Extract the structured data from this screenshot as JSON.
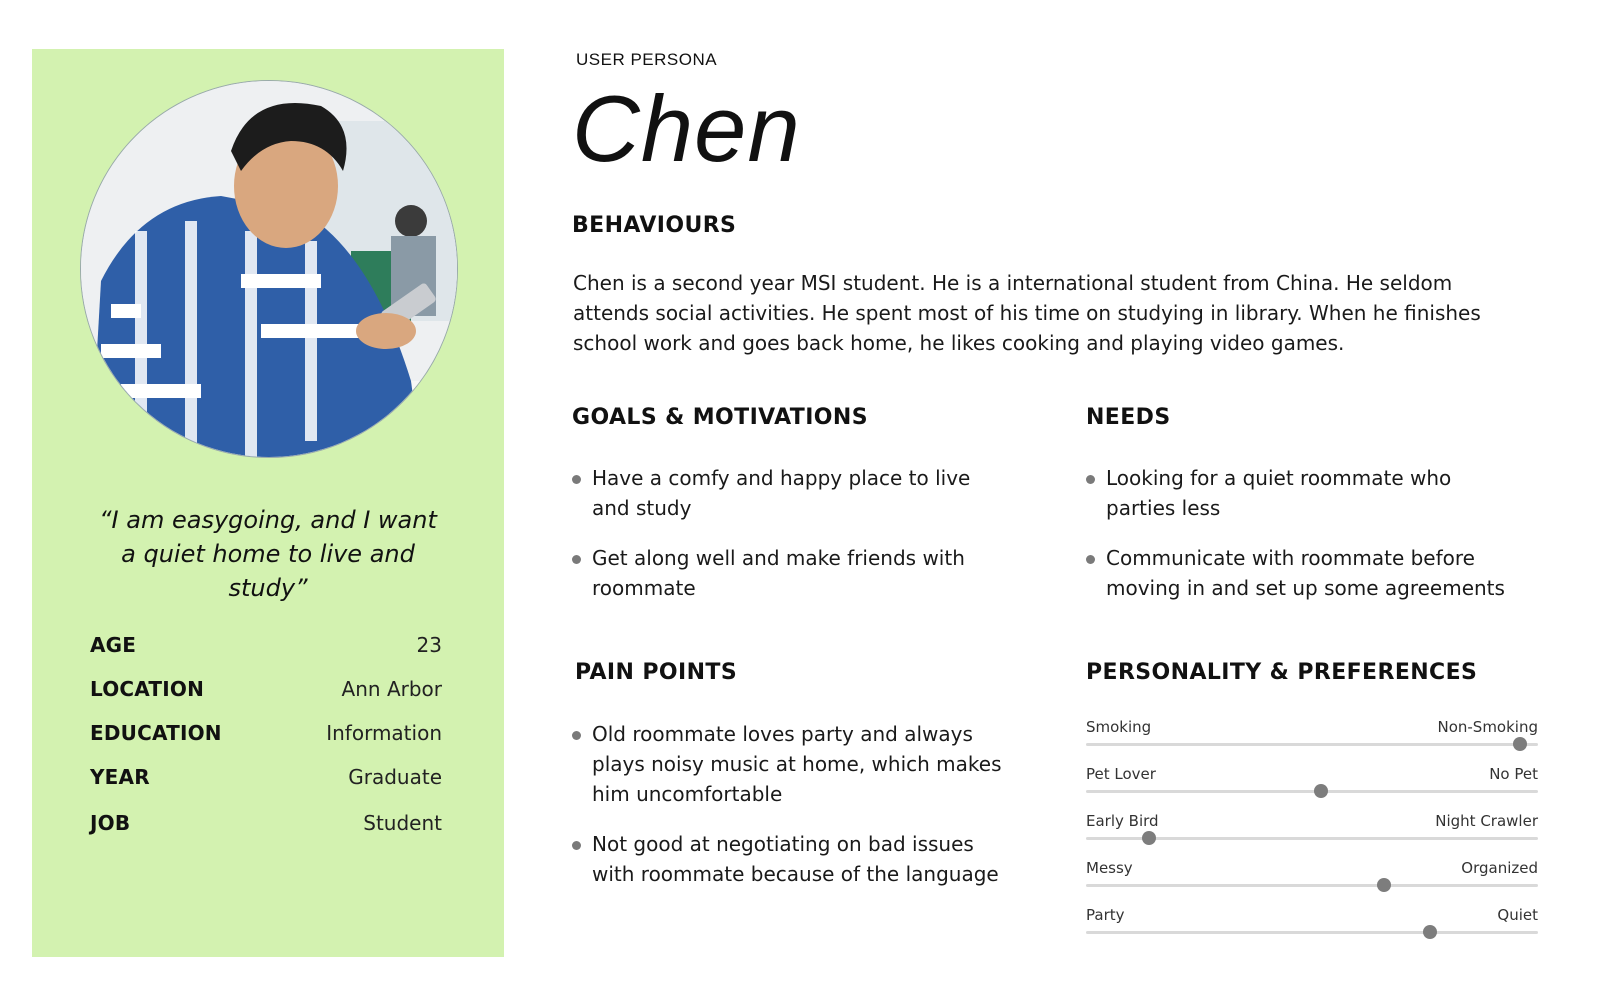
{
  "eyebrow": "USER PERSONA",
  "name": "Chen",
  "quote": "“I am easygoing, and I want a quiet home to live and study”",
  "info": [
    {
      "key": "AGE",
      "value": "23"
    },
    {
      "key": "LOCATION",
      "value": "Ann Arbor"
    },
    {
      "key": "EDUCATION",
      "value": "Information"
    },
    {
      "key": "YEAR",
      "value": "Graduate"
    },
    {
      "key": "JOB",
      "value": "Student"
    }
  ],
  "behaviours": {
    "title": "BEHAVIOURS",
    "text": "Chen is a second year MSI student. He is a international student from China. He seldom attends social activities. He spent most of his time on studying in library. When he finishes school work and goes back home, he likes cooking and playing video games."
  },
  "goals": {
    "title": "GOALS & MOTIVATIONS",
    "items": [
      "Have a comfy and happy place to live and study",
      "Get along well and make friends with roommate"
    ]
  },
  "needs": {
    "title": "NEEDS",
    "items": [
      "Looking for a quiet roommate who parties less",
      "Communicate with roommate before moving in and set up some agreements"
    ]
  },
  "pain_points": {
    "title": "PAIN POINTS",
    "items": [
      "Old roommate loves party and always plays noisy music at home, which makes him uncomfortable",
      "Not good at negotiating on bad issues with roommate because of the language"
    ]
  },
  "personality": {
    "title": "PERSONALITY & PREFERENCES",
    "sliders": [
      {
        "left": "Smoking",
        "right": "Non-Smoking",
        "value": 0.96
      },
      {
        "left": "Pet Lover",
        "right": "No Pet",
        "value": 0.52
      },
      {
        "left": "Early Bird",
        "right": "Night Crawler",
        "value": 0.14
      },
      {
        "left": "Messy",
        "right": "Organized",
        "value": 0.66
      },
      {
        "left": "Party",
        "right": "Quiet",
        "value": 0.76
      }
    ]
  },
  "colors": {
    "sidebar": "#d3f2b0",
    "slider_thumb": "#7d7d7d",
    "slider_track": "#d9d9d9"
  }
}
